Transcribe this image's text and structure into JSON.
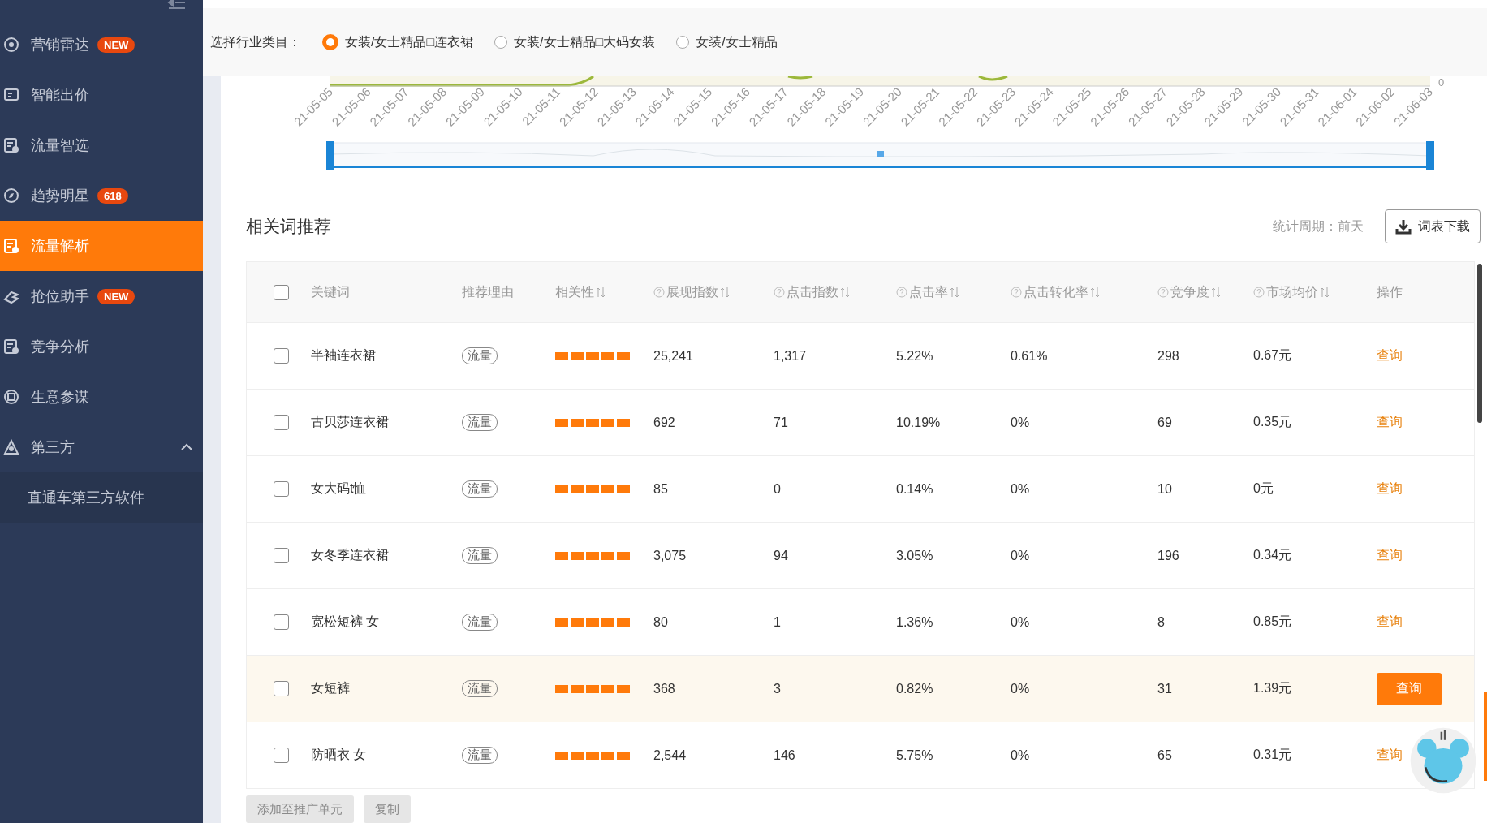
{
  "sidebar": {
    "items": [
      {
        "label": "营销雷达",
        "badge": "NEW",
        "selected": false
      },
      {
        "label": "智能出价",
        "selected": false
      },
      {
        "label": "流量智选",
        "selected": false
      },
      {
        "label": "趋势明星",
        "badge": "618",
        "selected": false
      },
      {
        "label": "流量解析",
        "selected": true
      },
      {
        "label": "抢位助手",
        "badge": "NEW",
        "selected": false
      },
      {
        "label": "竞争分析",
        "selected": false
      },
      {
        "label": "生意参谋",
        "selected": false
      },
      {
        "label": "第三方",
        "expanded": true,
        "selected": false,
        "children": [
          {
            "label": "直通车第三方软件",
            "selected": false
          }
        ]
      }
    ]
  },
  "industry": {
    "label": "选择行业类目：",
    "options": [
      {
        "label": "女装/女士精品□连衣裙",
        "selected": true
      },
      {
        "label": "女装/女士精品□大码女装",
        "selected": false
      },
      {
        "label": "女装/女士精品",
        "selected": false
      }
    ]
  },
  "trend": {
    "right_axis_label": "0",
    "dates": [
      "21-05-05",
      "21-05-06",
      "21-05-07",
      "21-05-08",
      "21-05-09",
      "21-05-10",
      "21-05-11",
      "21-05-12",
      "21-05-13",
      "21-05-14",
      "21-05-15",
      "21-05-16",
      "21-05-17",
      "21-05-18",
      "21-05-19",
      "21-05-20",
      "21-05-21",
      "21-05-22",
      "21-05-23",
      "21-05-24",
      "21-05-25",
      "21-05-26",
      "21-05-27",
      "21-05-28",
      "21-05-29",
      "21-05-30",
      "21-05-31",
      "21-06-01",
      "21-06-02",
      "21-06-03"
    ]
  },
  "related": {
    "title": "相关词推荐",
    "period_label": "统计周期：",
    "period": "前天",
    "download_button": "词表下载",
    "select_all": {
      "checked": false
    },
    "columns": [
      {
        "label": "关键词"
      },
      {
        "label": "推荐理由"
      },
      {
        "label": "相关性",
        "sortable": true
      },
      {
        "label": "展现指数",
        "help": true,
        "sortable": true
      },
      {
        "label": "点击指数",
        "help": true,
        "sortable": true
      },
      {
        "label": "点击率",
        "help": true,
        "sortable": true
      },
      {
        "label": "点击转化率",
        "help": true,
        "sortable": true
      },
      {
        "label": "竞争度",
        "help": true,
        "sortable": true
      },
      {
        "label": "市场均价",
        "help": true,
        "sortable": true
      },
      {
        "label": "操作"
      }
    ],
    "rows": [
      {
        "checked": false,
        "keyword": "半袖连衣裙",
        "reason": "流量",
        "stars": 5,
        "impressions": "25,241",
        "clicks": "1,317",
        "ctr": "5.22%",
        "cvr": "0.61%",
        "competition": "298",
        "price": "0.67元",
        "action": "查询",
        "highlighted": false
      },
      {
        "checked": false,
        "keyword": "古贝莎连衣裙",
        "reason": "流量",
        "stars": 5,
        "impressions": "692",
        "clicks": "71",
        "ctr": "10.19%",
        "cvr": "0%",
        "competition": "69",
        "price": "0.35元",
        "action": "查询",
        "highlighted": false
      },
      {
        "checked": false,
        "keyword": "女大码t恤",
        "reason": "流量",
        "stars": 5,
        "impressions": "85",
        "clicks": "0",
        "ctr": "0.14%",
        "cvr": "0%",
        "competition": "10",
        "price": "0元",
        "action": "查询",
        "highlighted": false
      },
      {
        "checked": false,
        "keyword": "女冬季连衣裙",
        "reason": "流量",
        "stars": 5,
        "impressions": "3,075",
        "clicks": "94",
        "ctr": "3.05%",
        "cvr": "0%",
        "competition": "196",
        "price": "0.34元",
        "action": "查询",
        "highlighted": false
      },
      {
        "checked": false,
        "keyword": "宽松短裤 女",
        "reason": "流量",
        "stars": 5,
        "impressions": "80",
        "clicks": "1",
        "ctr": "1.36%",
        "cvr": "0%",
        "competition": "8",
        "price": "0.85元",
        "action": "查询",
        "highlighted": false
      },
      {
        "checked": false,
        "keyword": "女短裤",
        "reason": "流量",
        "stars": 5,
        "impressions": "368",
        "clicks": "3",
        "ctr": "0.82%",
        "cvr": "0%",
        "competition": "31",
        "price": "1.39元",
        "action": "查询",
        "highlighted": true
      },
      {
        "checked": false,
        "keyword": "防晒衣 女",
        "reason": "流量",
        "stars": 5,
        "impressions": "2,544",
        "clicks": "146",
        "ctr": "5.75%",
        "cvr": "0%",
        "competition": "65",
        "price": "0.31元",
        "action": "查询",
        "highlighted": false
      }
    ],
    "footer_buttons": [
      {
        "label": "添加至推广单元",
        "disabled": true
      },
      {
        "label": "复制",
        "disabled": true
      }
    ]
  }
}
